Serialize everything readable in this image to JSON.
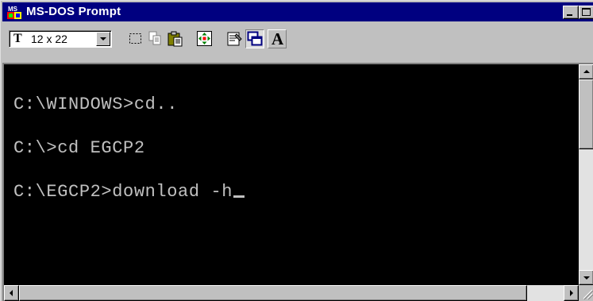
{
  "window": {
    "title": "MS-DOS Prompt",
    "titlebar_color": "#000080",
    "icon": "ms-dos-icon"
  },
  "toolbar": {
    "font_size_value": "12 x 22",
    "font_glyph": "T",
    "font_button_label": "A",
    "buttons": [
      "mark-icon",
      "copy-icon",
      "paste-icon",
      "full-screen-icon",
      "properties-icon",
      "background-icon",
      "font-icon"
    ]
  },
  "console": {
    "background": "#000000",
    "text_color": "#c0c0c0",
    "lines": [
      "C:\\WINDOWS>cd..",
      "C:\\>cd EGCP2",
      "C:\\EGCP2>download -h"
    ]
  }
}
